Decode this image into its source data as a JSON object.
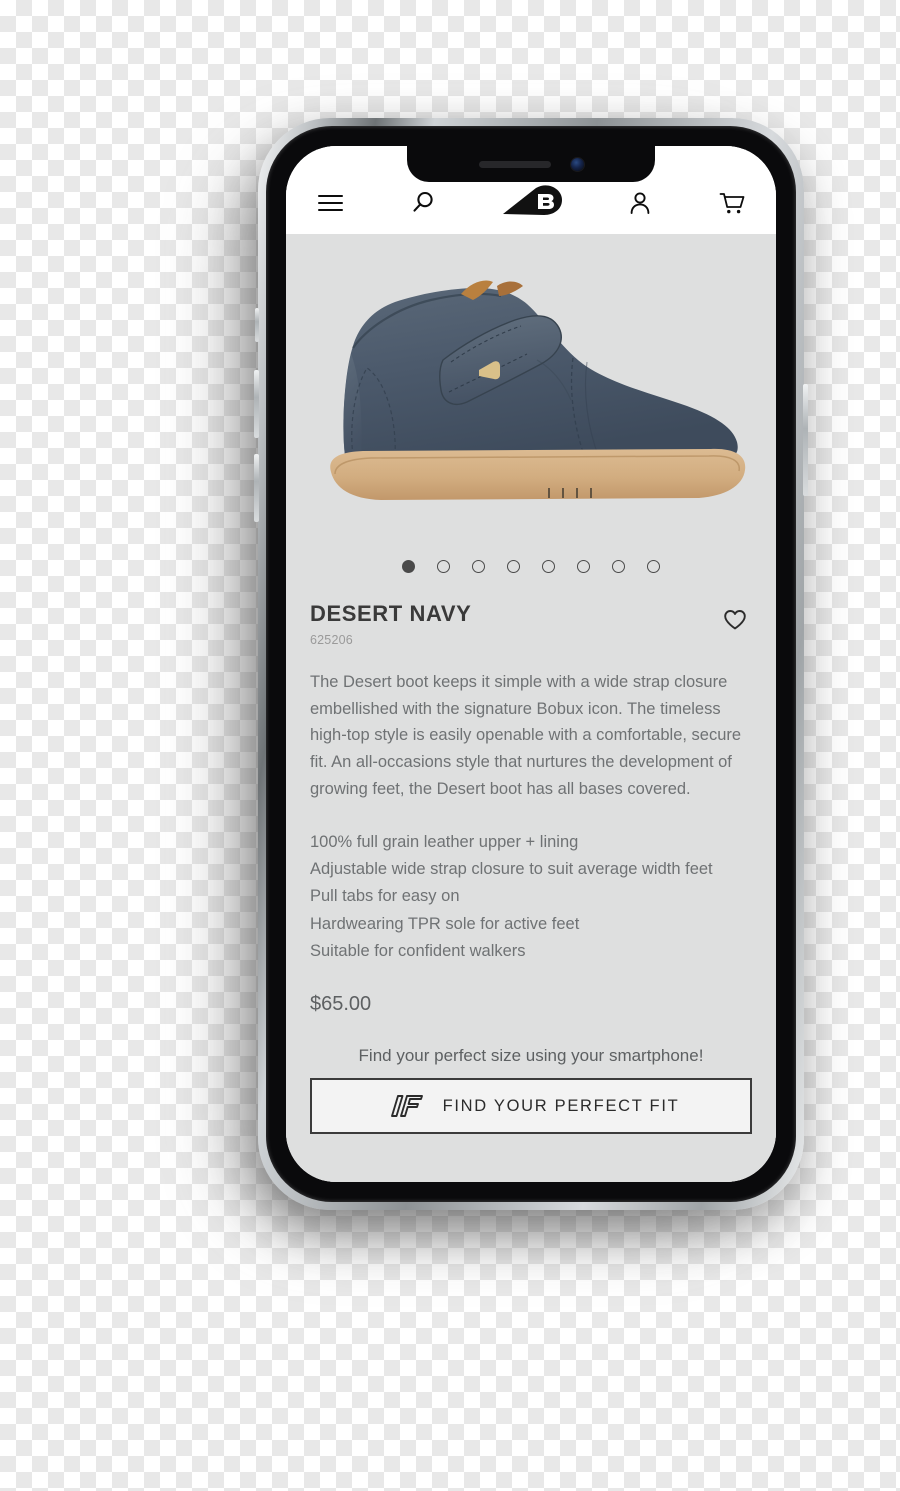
{
  "nav": {
    "menu_icon": "hamburger-menu-icon",
    "search_icon": "search-icon",
    "brand_logo": "bobux-logo",
    "account_icon": "user-account-icon",
    "cart_icon": "shopping-cart-icon"
  },
  "gallery": {
    "image_alt": "navy leather toddler desert boot with velcro strap and gum sole",
    "total_slides": 8,
    "active_slide": 1
  },
  "product": {
    "title": "DESERT NAVY",
    "sku": "625206",
    "wishlist_icon": "heart-outline-icon",
    "description": "The Desert boot keeps it simple with a wide strap closure embellished with the signature Bobux icon. The timeless high-top style is easily openable with a comfortable, secure fit. An all-occasions style that nurtures the development of growing feet, the Desert boot has all bases covered.",
    "features": [
      "100% full grain leather upper + lining",
      "Adjustable wide strap closure to suit average width feet",
      "Pull tabs for easy on",
      "Hardwearing TPR sole for active feet",
      "Suitable for confident walkers"
    ],
    "price": "$65.00"
  },
  "fit_finder": {
    "tagline": "Find your perfect size using your smartphone!",
    "button_label": "FIND YOUR PERFECT FIT",
    "button_icon": "fit-finder-logo-icon"
  },
  "colors": {
    "page_background": "#dedfdf",
    "navbar_background": "#ffffff",
    "text_primary": "#3a3a3a",
    "text_muted": "#6f7274",
    "sku_grey": "#9a9a9a",
    "accent_black": "#0d0d0d",
    "button_border": "#3b3b3b",
    "button_fill": "#f3f3f3",
    "shoe_navy": "#4d5a6e",
    "shoe_sole_gum": "#d6b183"
  }
}
